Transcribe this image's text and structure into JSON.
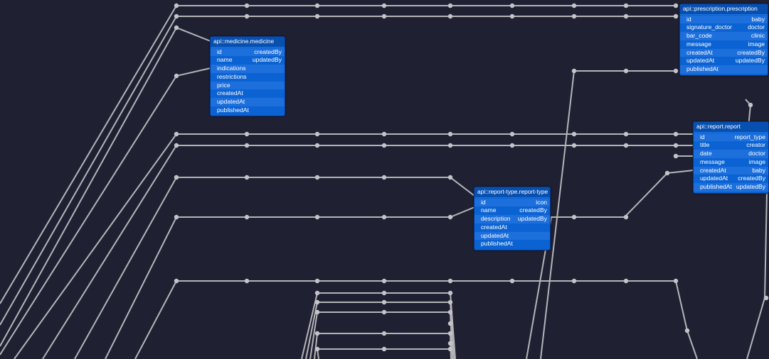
{
  "entities": [
    {
      "key": "medicine",
      "title": "api::medicine.medicine",
      "rows": [
        [
          "id",
          "createdBy"
        ],
        [
          "name",
          "updatedBy"
        ],
        [
          "indications",
          ""
        ],
        [
          "restrictions",
          ""
        ],
        [
          "price",
          ""
        ],
        [
          "createdAt",
          ""
        ],
        [
          "updatedAt",
          ""
        ],
        [
          "publishedAt",
          ""
        ]
      ]
    },
    {
      "key": "prescription",
      "title": "api::prescription.prescription",
      "rows": [
        [
          "id",
          "baby"
        ],
        [
          "signature_doctor",
          "doctor"
        ],
        [
          "bar_code",
          "clinic"
        ],
        [
          "message",
          "image"
        ],
        [
          "createdAt",
          "createdBy"
        ],
        [
          "updatedAt",
          "updatedBy"
        ],
        [
          "publishedAt",
          ""
        ]
      ]
    },
    {
      "key": "report",
      "title": "api::report.report",
      "rows": [
        [
          "id",
          "report_type"
        ],
        [
          "title",
          "creator"
        ],
        [
          "date",
          "doctor"
        ],
        [
          "message",
          "image"
        ],
        [
          "createdAt",
          "baby"
        ],
        [
          "updatedAt",
          "createdBy"
        ],
        [
          "publishedAt",
          "updatedBy"
        ]
      ]
    },
    {
      "key": "report_type",
      "title": "api::report-type.report-type",
      "rows": [
        [
          "id",
          "icon"
        ],
        [
          "name",
          "createdBy"
        ],
        [
          "description",
          "updatedBy"
        ],
        [
          "createdAt",
          ""
        ],
        [
          "updatedAt",
          ""
        ],
        [
          "publishedAt",
          ""
        ]
      ]
    }
  ]
}
